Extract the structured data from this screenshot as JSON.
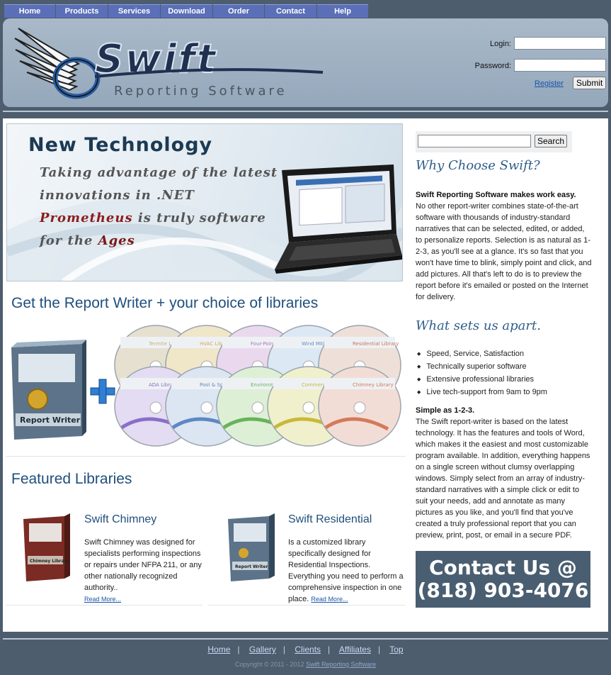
{
  "nav": {
    "items": [
      {
        "label": "Home"
      },
      {
        "label": "Products"
      },
      {
        "label": "Services"
      },
      {
        "label": "Download"
      },
      {
        "label": "Order"
      },
      {
        "label": "Contact"
      },
      {
        "label": "Help"
      }
    ]
  },
  "logo": {
    "name": "Swift",
    "tagline": "Reporting Software"
  },
  "login": {
    "login_label": "Login:",
    "password_label": "Password:",
    "login_value": "",
    "password_value": "",
    "register_link": "Register",
    "submit_label": "Submit"
  },
  "hero": {
    "title": "New Technology",
    "line1": "Taking advantage of the latest",
    "line2": "innovations in .NET",
    "line3_em": "Prometheus",
    "line3_rest": " is truly software",
    "line4_pre": "for the ",
    "line4_em": "Ages"
  },
  "libraries": {
    "heading": "Get the Report Writer + your choice of libraries",
    "box_label": "Report Writer",
    "discs": [
      "Termite Library",
      "HVAC Library",
      "Four-Point Library",
      "Wind Mitigation Library",
      "Residential Library",
      "ADA Library",
      "Pool & Spa Library",
      "Environmental Library",
      "Commercial Library",
      "Chimney Library"
    ]
  },
  "featured": {
    "heading": "Featured Libraries",
    "items": [
      {
        "title": "Swift Chimney",
        "text": "Swift Chimney was designed for specialists performing inspections or repairs under NFPA 211, or any other nationally recognized authority..",
        "more": "Read More...",
        "box_label": "Chimney Library"
      },
      {
        "title": "Swift Residential",
        "text": "Is a customized library specifically designed for Residential Inspections. Everything you need to perform a comprehensive inspection in one place.",
        "more": "Read More...",
        "box_label": "Report Writer"
      }
    ]
  },
  "sidebar": {
    "search_value": "",
    "search_button": "Search",
    "why_heading": "Why Choose Swift?",
    "why_lead": "Swift Reporting Software makes work easy.",
    "why_text": "No other report-writer combines state-of-the-art software with thousands of industry-standard narratives that can be selected, edited, or added, to personalize reports. Selection is as natural as 1-2-3, as you'll see at a glance. It's so fast that you won't have time to blink, simply point and click, and add pictures. All that's left to do is to preview the report before it's emailed or posted on the Internet for delivery.",
    "apart_heading": "What sets us apart.",
    "bullets": [
      "Speed, Service, Satisfaction",
      "Technically superior software",
      "Extensive professional libraries",
      "Live tech-support from 9am to 9pm"
    ],
    "simple_lead": "Simple as 1-2-3.",
    "simple_text": "The Swift report-writer is based on the latest technology. It has the features and tools of Word, which makes it the easiest and most customizable program available. In addition, everything happens on a single screen without clumsy overlapping windows. Simply select from an array of industry-standard narratives with a simple click or edit to suit your needs, add and annotate as many pictures as you like, and you'll find that you've created a truly professional report that you can preview, print, post, or email in a secure PDF.",
    "contact_line1": "Contact Us @",
    "contact_line2": "(818) 903-4076"
  },
  "footer": {
    "links": [
      "Home",
      "Gallery",
      "Clients",
      "Affiliates",
      "Top"
    ],
    "copyright": "Copyright © 2011 - 2012",
    "copyright_link": "Swift Reporting Software"
  },
  "colors": {
    "nav_bg": "#5a6fb8",
    "page_bg": "#4d5d6d",
    "heading_blue": "#1f4f7d",
    "contact_bg": "#4a5e71"
  }
}
